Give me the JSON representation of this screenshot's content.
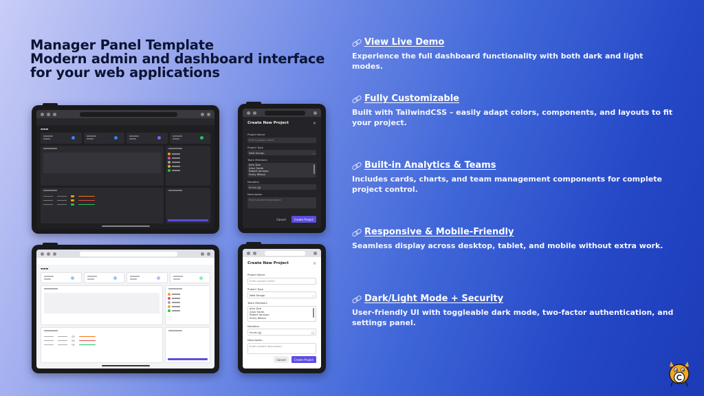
{
  "title": {
    "line1": "Manager Panel Template",
    "line2": "Modern admin and dashboard interface",
    "line3": "for your web applications"
  },
  "modal": {
    "title": "Create New Project",
    "project_name_label": "Project Name",
    "project_name_placeholder": "Enter project name",
    "project_type_label": "Project Type",
    "project_type_value": "Web Design",
    "team_members_label": "Team Members",
    "team_members": [
      "John Doe",
      "Alice Smith",
      "Robert Johnson",
      "Emily Wilson"
    ],
    "deadline_label": "Deadline",
    "deadline_value": "tt.mm.jjjj",
    "description_label": "Description",
    "description_placeholder": "Enter project description",
    "cancel_label": "Cancel",
    "create_label": "Create Project"
  },
  "features": [
    {
      "heading": "View Live Demo",
      "description": "Experience the full dashboard functionality with both dark and light modes."
    },
    {
      "heading": "Fully Customizable",
      "description": "Built with TailwindCSS – easily adapt colors, components, and layouts to fit your project."
    },
    {
      "heading": "Built-in Analytics & Teams",
      "description": "Includes cards, charts, and team management components for complete project control."
    },
    {
      "heading": "Responsive & Mobile-Friendly",
      "description": "Seamless display across desktop, tablet, and mobile without extra work."
    },
    {
      "heading": "Dark/Light Mode + Security",
      "description": "User-friendly UI with toggleable dark mode, two-factor authentication, and settings panel."
    }
  ],
  "colors": {
    "accent": "#5b4de0",
    "title_text": "#0c1433",
    "background_start": "#c9cdf6",
    "background_end": "#1c3bb8"
  },
  "icons": {
    "feature_icon": "link-icon",
    "mascot": "mascot-icon"
  }
}
